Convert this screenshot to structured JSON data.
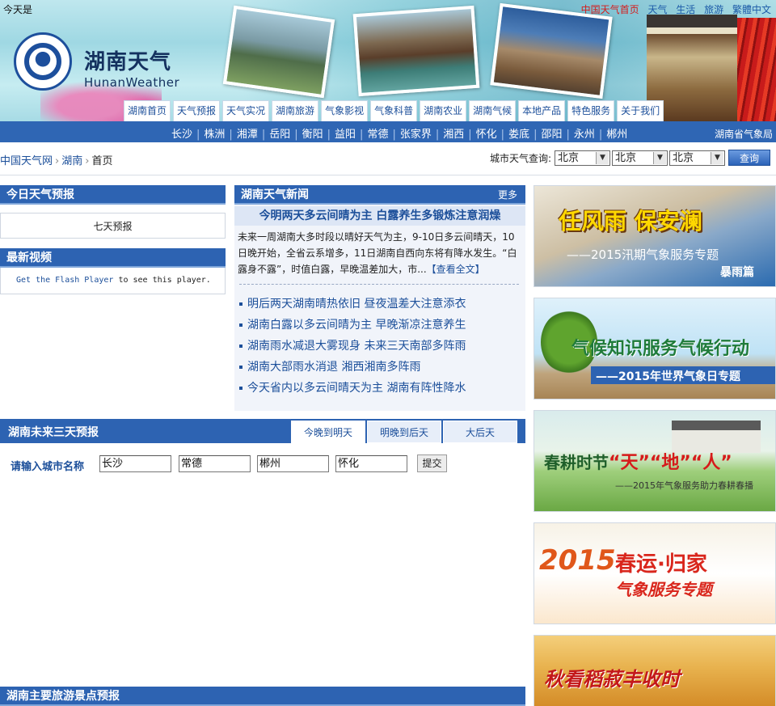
{
  "top": {
    "today_label": "今天是",
    "links": [
      {
        "label": "中国天气首页",
        "style": "home"
      },
      {
        "label": "天气",
        "style": "blue"
      },
      {
        "label": "生活",
        "style": "blue"
      },
      {
        "label": "旅游",
        "style": "blue"
      },
      {
        "label": "繁體中文",
        "style": "blue"
      }
    ]
  },
  "logo": {
    "name_cn": "湖南天气",
    "name_en": "HunanWeather"
  },
  "main_nav": [
    "湖南首页",
    "天气预报",
    "天气实况",
    "湖南旅游",
    "气象影视",
    "气象科普",
    "湖南农业",
    "湖南气候",
    "本地产品",
    "特色服务",
    "关于我们"
  ],
  "cities": [
    "长沙",
    "株洲",
    "湘潭",
    "岳阳",
    "衡阳",
    "益阳",
    "常德",
    "张家界",
    "湘西",
    "怀化",
    "娄底",
    "邵阳",
    "永州",
    "郴州"
  ],
  "bureau": "湖南省气象局",
  "breadcrumb": {
    "root": "中国天气网",
    "region": "湖南",
    "current": "首页"
  },
  "city_query": {
    "label": "城市天气查询:",
    "selects": [
      "北京",
      "北京",
      "北京"
    ],
    "button": "查询"
  },
  "today_forecast": {
    "title": "今日天气预报",
    "link": "七天预报"
  },
  "latest_video": {
    "title": "最新视频",
    "flash_link": "Get the Flash Player",
    "flash_text": " to see this player."
  },
  "news": {
    "title": "湖南天气新闻",
    "more": "更多",
    "headline": "今明两天多云间晴为主 白露养生多锻炼注意润燥",
    "summary": "未来一周湖南大多时段以晴好天气为主，9-10日多云间晴天，10日晚开始，全省云系增多，11日湖南自西向东将有降水发生。“白露身不露”，时值白露，早晚温差加大，市...",
    "full_link": "【查看全文】",
    "items": [
      "明后两天湖南晴热依旧 昼夜温差大注意添衣",
      "湖南白露以多云间晴为主 早晚渐凉注意养生",
      "湖南雨水减退大雾现身 未来三天南部多阵雨",
      "湖南大部雨水消退 湘西湘南多阵雨",
      "今天省内以多云间晴天为主 湖南有阵性降水"
    ]
  },
  "three_day": {
    "title": "湖南未来三天预报",
    "tabs": [
      "今晚到明天",
      "明晚到后天",
      "大后天"
    ],
    "input_label": "请输入城市名称",
    "inputs": [
      "长沙",
      "常德",
      "郴州",
      "怀化"
    ],
    "submit": "提交"
  },
  "tourism": {
    "title": "湖南主要旅游景点预报"
  },
  "banners": [
    {
      "main": "任风雨 保安澜",
      "sub": "——2015汛期气象服务专题",
      "tag": "暴雨篇"
    },
    {
      "main": "气候知识服务气候行动",
      "sub": "——2015年世界气象日专题"
    },
    {
      "main_prefix": "春耕时节",
      "quote1": "“天”",
      "quote2": "“地”",
      "quote3": "“人”",
      "sub": "——2015年气象服务助力春耕春播"
    },
    {
      "year": "2015",
      "main": "春运·归家",
      "sub": "气象服务专题"
    },
    {
      "main": "秋看稻菽丰收时"
    }
  ],
  "colors": {
    "nav_blue": "#2d63b2",
    "link_blue": "#1c4f9a",
    "home_red": "#d61a1a"
  }
}
